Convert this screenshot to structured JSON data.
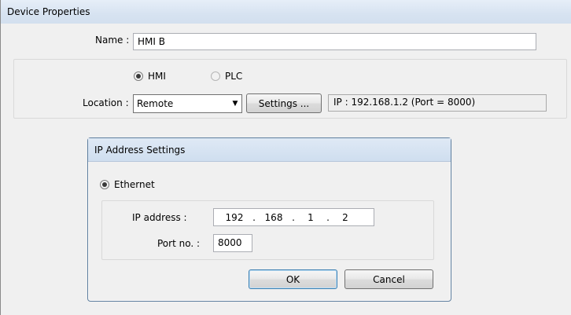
{
  "window": {
    "title": "Device Properties"
  },
  "name_field": {
    "label": "Name :",
    "value": "HMI B"
  },
  "device_type": {
    "options": [
      "HMI",
      "PLC"
    ],
    "selected": "HMI"
  },
  "location": {
    "label": "Location :",
    "value": "Remote",
    "settings_label": "Settings ...",
    "info": "IP : 192.168.1.2 (Port = 8000)"
  },
  "ip_dialog": {
    "title": "IP Address Settings",
    "ethernet_label": "Ethernet",
    "ip_label": "IP address :",
    "ip_parts": [
      "192",
      "168",
      "1",
      "2"
    ],
    "port_label": "Port no. :",
    "port_value": "8000",
    "ok_label": "OK",
    "cancel_label": "Cancel"
  }
}
